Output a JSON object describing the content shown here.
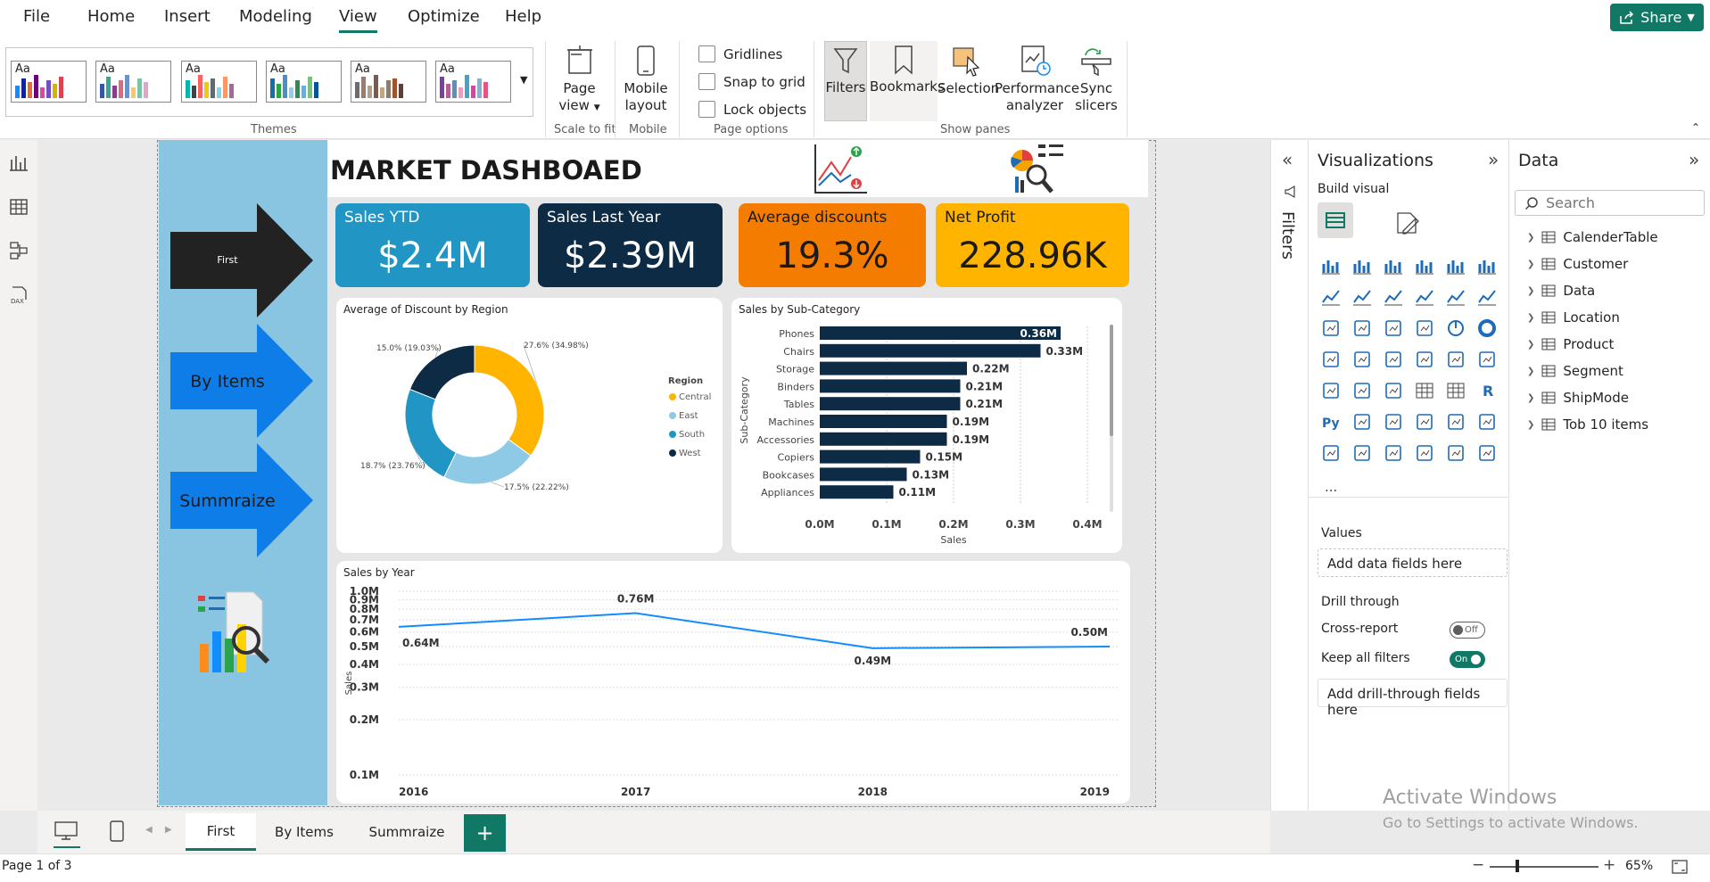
{
  "menu": {
    "file": "File",
    "home": "Home",
    "insert": "Insert",
    "modeling": "Modeling",
    "view": "View",
    "optimize": "Optimize",
    "help": "Help",
    "share": "Share"
  },
  "ribbon": {
    "themes_label": "Themes",
    "theme_aa": "Aa",
    "page_view": "Page view",
    "scale_to_fit": "Scale to fit",
    "mobile_layout": "Mobile layout",
    "mobile_group": "Mobile",
    "gridlines": "Gridlines",
    "snap_to_grid": "Snap to grid",
    "lock_objects": "Lock objects",
    "page_options": "Page options",
    "filters": "Filters",
    "bookmarks": "Bookmarks",
    "selection": "Selection",
    "performance_analyzer": "Performance analyzer",
    "sync_slicers": "Sync slicers",
    "show_panes": "Show panes"
  },
  "report": {
    "title": "MARKET DASHBOAED",
    "nav": {
      "first": "First",
      "by_items": "By Items",
      "summraize": "Summraize"
    },
    "kpis": [
      {
        "title": "Sales YTD",
        "value": "$2.4M",
        "color": "#2196c4"
      },
      {
        "title": "Sales Last Year",
        "value": "$2.39M",
        "color": "#0d2b45"
      },
      {
        "title": "Average discounts",
        "value": "19.3%",
        "color": "#f47c00"
      },
      {
        "title": "Net Profit",
        "value": "228.96K",
        "color": "#ffb400"
      }
    ]
  },
  "chart_data": [
    {
      "type": "pie",
      "title": "Average of Discount by Region",
      "legend_title": "Region",
      "legend_position": "right",
      "labels": [
        "Central",
        "East",
        "South",
        "West"
      ],
      "values": [
        27.6,
        17.5,
        18.7,
        15.0
      ],
      "data_labels": [
        "27.6% (34.98%)",
        "17.5% (22.22%)",
        "18.7% (23.76%)",
        "15.0% (19.03%)"
      ],
      "colors": [
        "#ffb400",
        "#8ecae6",
        "#2196c4",
        "#0d2b45"
      ]
    },
    {
      "type": "bar",
      "title": "Sales by Sub-Category",
      "orientation": "horizontal",
      "categories": [
        "Phones",
        "Chairs",
        "Storage",
        "Binders",
        "Tables",
        "Machines",
        "Accessories",
        "Copiers",
        "Bookcases",
        "Appliances"
      ],
      "values": [
        0.36,
        0.33,
        0.22,
        0.21,
        0.21,
        0.19,
        0.19,
        0.15,
        0.13,
        0.11
      ],
      "data_labels": [
        "0.36M",
        "0.33M",
        "0.22M",
        "0.21M",
        "0.21M",
        "0.19M",
        "0.19M",
        "0.15M",
        "0.13M",
        "0.11M"
      ],
      "xlabel": "Sales",
      "ylabel": "Sub-Category",
      "xticks": [
        "0.0M",
        "0.1M",
        "0.2M",
        "0.3M",
        "0.4M"
      ],
      "xlim": [
        0,
        0.4
      ],
      "color": "#0d2b45"
    },
    {
      "type": "line",
      "title": "Sales by Year",
      "x": [
        "2016",
        "2017",
        "2018",
        "2019"
      ],
      "values": [
        0.64,
        0.76,
        0.49,
        0.5
      ],
      "data_labels": [
        "0.64M",
        "0.76M",
        "0.49M",
        "0.50M"
      ],
      "ylabel": "Sales",
      "scale": "log",
      "yticks": [
        {
          "v": 1.0,
          "l": "1.0M"
        },
        {
          "v": 0.9,
          "l": "0.9M"
        },
        {
          "v": 0.8,
          "l": "0.8M"
        },
        {
          "v": 0.7,
          "l": "0.7M"
        },
        {
          "v": 0.6,
          "l": "0.6M"
        },
        {
          "v": 0.5,
          "l": "0.5M"
        },
        {
          "v": 0.4,
          "l": "0.4M"
        },
        {
          "v": 0.3,
          "l": "0.3M"
        },
        {
          "v": 0.2,
          "l": "0.2M"
        },
        {
          "v": 0.1,
          "l": "0.1M"
        }
      ],
      "ylim": [
        0.1,
        1.0
      ],
      "color": "#118dff"
    }
  ],
  "filters_pane": {
    "label": "Filters"
  },
  "viz_pane": {
    "title": "Visualizations",
    "build_visual": "Build visual",
    "values": "Values",
    "add_data_fields": "Add data fields here",
    "drill_through": "Drill through",
    "cross_report": "Cross-report",
    "cross_report_state": "Off",
    "keep_all_filters": "Keep all filters",
    "keep_all_filters_state": "On",
    "add_drill": "Add drill-through fields here",
    "more": "..."
  },
  "data_pane": {
    "title": "Data",
    "search_placeholder": "Search",
    "tables": [
      "CalenderTable",
      "Customer",
      "Data",
      "Location",
      "Product",
      "Segment",
      "ShipMode",
      "Tob 10 items"
    ]
  },
  "tabs": [
    "First",
    "By Items",
    "Summraize"
  ],
  "status": {
    "page": "Page 1 of 3",
    "zoom": "65%"
  },
  "watermark": {
    "line1": "Activate Windows",
    "line2": "Go to Settings to activate Windows."
  }
}
